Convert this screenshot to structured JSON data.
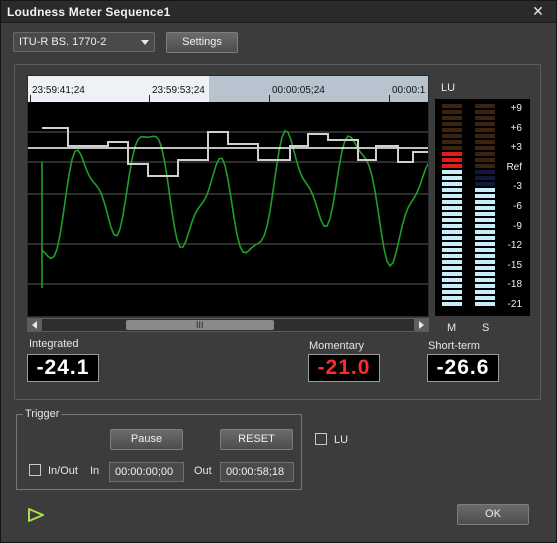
{
  "window": {
    "title": "Loudness Meter  Sequence1",
    "close_glyph": "✕"
  },
  "toolbar": {
    "standard_value": "ITU-R BS. 1770-2",
    "settings_label": "Settings"
  },
  "graph": {
    "timecodes": [
      "23:59:41;24",
      "23:59:53;24",
      "00:00:05;24",
      "00:00:1"
    ],
    "scroll_grip": "III",
    "colors": {
      "momentary": "#1e9e2a",
      "short_term": "#cfcfcf",
      "reference": "#ffffff"
    }
  },
  "meter": {
    "unit_label": "LU",
    "scale": [
      "+9",
      "+6",
      "+3",
      "Ref",
      "-3",
      "-6",
      "-9",
      "-12",
      "-15",
      "-18",
      "-21"
    ],
    "column_labels": [
      "M",
      "S"
    ]
  },
  "readouts": {
    "integrated": {
      "label": "Integrated",
      "value": "-24.1",
      "color": "#ffffff"
    },
    "momentary": {
      "label": "Momentary",
      "value": "-21.0",
      "color": "#ff2a2a"
    },
    "short_term": {
      "label": "Short-term",
      "value": "-26.6",
      "color": "#ffffff"
    }
  },
  "trigger": {
    "title": "Trigger",
    "pause_label": "Pause",
    "reset_label": "RESET",
    "in_out_label": "In/Out",
    "in_label": "In",
    "in_value": "00:00:00;00",
    "out_label": "Out",
    "out_value": "00:00:58;18"
  },
  "lu_checkbox_label": "LU",
  "footer": {
    "ok_label": "OK",
    "play_icon": "play-icon"
  }
}
